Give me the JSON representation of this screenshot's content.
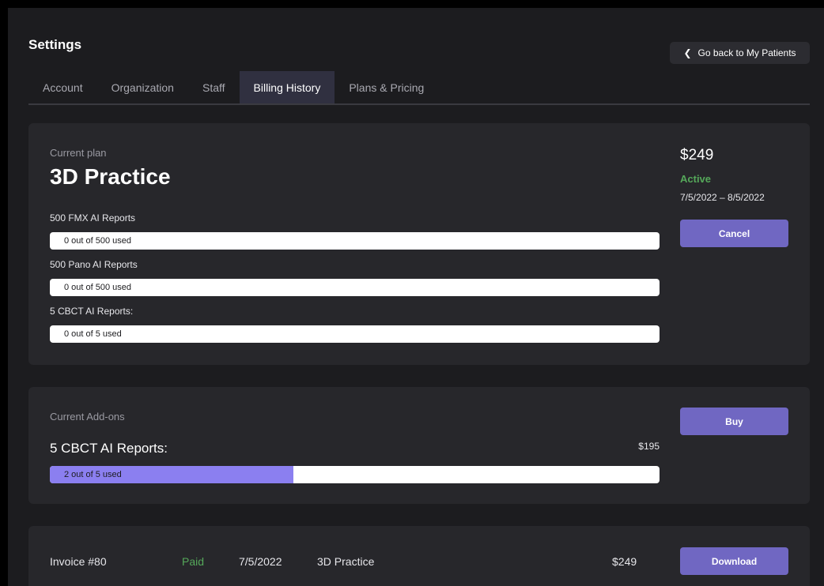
{
  "header": {
    "title": "Settings",
    "back_label": "Go back to My Patients",
    "back_icon": "chevron-left-icon"
  },
  "tabs": [
    {
      "label": "Account",
      "active": false
    },
    {
      "label": "Organization",
      "active": false
    },
    {
      "label": "Staff",
      "active": false
    },
    {
      "label": "Billing History",
      "active": true
    },
    {
      "label": "Plans & Pricing",
      "active": false
    }
  ],
  "plan": {
    "section_label": "Current plan",
    "name": "3D Practice",
    "price": "$249",
    "status": "Active",
    "period": "7/5/2022 – 8/5/2022",
    "cancel_label": "Cancel",
    "quotas": [
      {
        "label": "500 FMX AI Reports",
        "usage": "0 out of 500 used",
        "used": 0,
        "total": 500
      },
      {
        "label": "500 Pano AI Reports",
        "usage": "0 out of 500 used",
        "used": 0,
        "total": 500
      },
      {
        "label": "5 CBCT AI Reports:",
        "usage": "0 out of 5 used",
        "used": 0,
        "total": 5
      }
    ]
  },
  "addons": {
    "section_label": "Current Add-ons",
    "buy_label": "Buy",
    "item": {
      "name": "5 CBCT AI Reports:",
      "price": "$195",
      "usage": "2 out of 5 used",
      "used": 2,
      "total": 5
    }
  },
  "invoice": {
    "number": "Invoice #80",
    "status": "Paid",
    "date": "7/5/2022",
    "plan": "3D Practice",
    "amount": "$249",
    "download_label": "Download"
  },
  "colors": {
    "accent": "#7067c2",
    "progress_fill": "#8b7ff0",
    "status_green": "#55a85a",
    "background": "#1c1c1f",
    "card": "#27272b"
  }
}
